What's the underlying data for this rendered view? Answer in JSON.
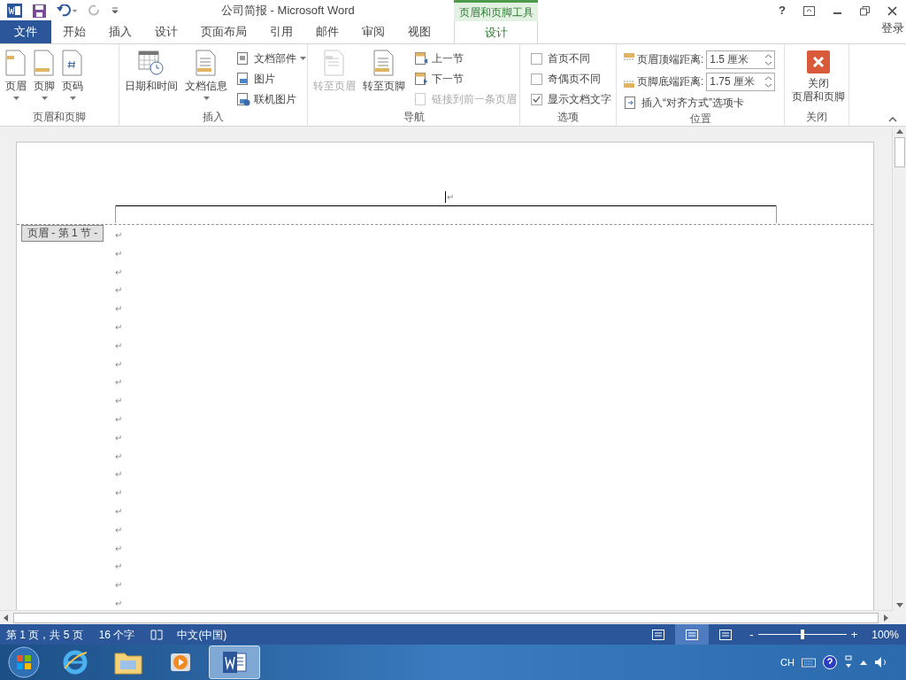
{
  "title_bar": {
    "title": "公司简报 - Microsoft Word",
    "context_label": "页眉和页脚工具",
    "help": "?",
    "sign_in": "登录"
  },
  "tabs": [
    {
      "label": "文件",
      "kind": "file",
      "selected": false
    },
    {
      "label": "开始",
      "kind": "normal",
      "selected": false
    },
    {
      "label": "插入",
      "kind": "normal",
      "selected": false
    },
    {
      "label": "设计",
      "kind": "normal",
      "selected": false
    },
    {
      "label": "页面布局",
      "kind": "normal",
      "selected": false
    },
    {
      "label": "引用",
      "kind": "normal",
      "selected": false
    },
    {
      "label": "邮件",
      "kind": "normal",
      "selected": false
    },
    {
      "label": "审阅",
      "kind": "normal",
      "selected": false
    },
    {
      "label": "视图",
      "kind": "normal",
      "selected": false
    },
    {
      "label": "设计",
      "kind": "contextual",
      "selected": true
    }
  ],
  "ribbon": [
    {
      "name": "页眉和页脚",
      "items": [
        {
          "kind": "large",
          "label": "页眉",
          "dropdown": true,
          "disabled": false
        },
        {
          "kind": "large",
          "label": "页脚",
          "dropdown": true,
          "disabled": false
        },
        {
          "kind": "large",
          "label": "页码",
          "dropdown": true,
          "disabled": false
        }
      ]
    },
    {
      "name": "插入",
      "items": [
        {
          "kind": "large",
          "label": "日期和时间",
          "dropdown": false,
          "disabled": false
        },
        {
          "kind": "large",
          "label": "文档信息",
          "dropdown": true,
          "disabled": false
        },
        {
          "kind": "small",
          "label": "文档部件",
          "dropdown": true,
          "disabled": false
        },
        {
          "kind": "small",
          "label": "图片",
          "dropdown": false,
          "disabled": false
        },
        {
          "kind": "small",
          "label": "联机图片",
          "dropdown": false,
          "disabled": false
        }
      ]
    },
    {
      "name": "导航",
      "items": [
        {
          "kind": "large",
          "label": "转至页眉",
          "dropdown": false,
          "disabled": true
        },
        {
          "kind": "large",
          "label": "转至页脚",
          "dropdown": false,
          "disabled": false
        },
        {
          "kind": "small",
          "label": "上一节",
          "dropdown": false,
          "disabled": false
        },
        {
          "kind": "small",
          "label": "下一节",
          "dropdown": false,
          "disabled": false
        },
        {
          "kind": "small",
          "label": "链接到前一条页眉",
          "dropdown": false,
          "disabled": true
        }
      ]
    },
    {
      "name": "选项",
      "items": [
        {
          "kind": "checkbox",
          "label": "首页不同",
          "checked": false
        },
        {
          "kind": "checkbox",
          "label": "奇偶页不同",
          "checked": false
        },
        {
          "kind": "checkbox",
          "label": "显示文档文字",
          "checked": true
        }
      ]
    },
    {
      "name": "位置",
      "items": [
        {
          "kind": "spinner",
          "label": "页眉顶端距离:",
          "value": "1.5 厘米"
        },
        {
          "kind": "spinner",
          "label": "页脚底端距离:",
          "value": "1.75 厘米"
        },
        {
          "kind": "small",
          "label": "插入“对齐方式”选项卡",
          "dropdown": false,
          "disabled": false
        }
      ]
    },
    {
      "name": "关闭",
      "items": [
        {
          "kind": "close",
          "lines": [
            "关闭",
            "页眉和页脚"
          ]
        }
      ]
    }
  ],
  "document": {
    "header_mark": "↵",
    "header_tag": "页眉 - 第 1 节 -",
    "paragraph_marks": [
      "↵",
      "↵",
      "↵",
      "↵",
      "↵",
      "↵",
      "↵",
      "↵",
      "↵",
      "↵",
      "↵",
      "↵",
      "↵",
      "↵",
      "↵",
      "↵",
      "↵",
      "↵",
      "↵",
      "↵",
      "↵"
    ]
  },
  "status_bar": {
    "page": "第 1 页，共 5 页",
    "words": "16 个字",
    "language": "中文(中国)",
    "views": [
      {
        "selected": false
      },
      {
        "selected": true
      },
      {
        "selected": false
      }
    ],
    "zoom_minus": "-",
    "zoom_plus": "+",
    "zoom": {
      "level": 0.5
    },
    "zoom_text": "100%"
  },
  "taskbar": {
    "apps": [
      {
        "selected": false
      },
      {
        "selected": false
      },
      {
        "selected": false
      },
      {
        "selected": true
      }
    ],
    "ime": "CH"
  }
}
